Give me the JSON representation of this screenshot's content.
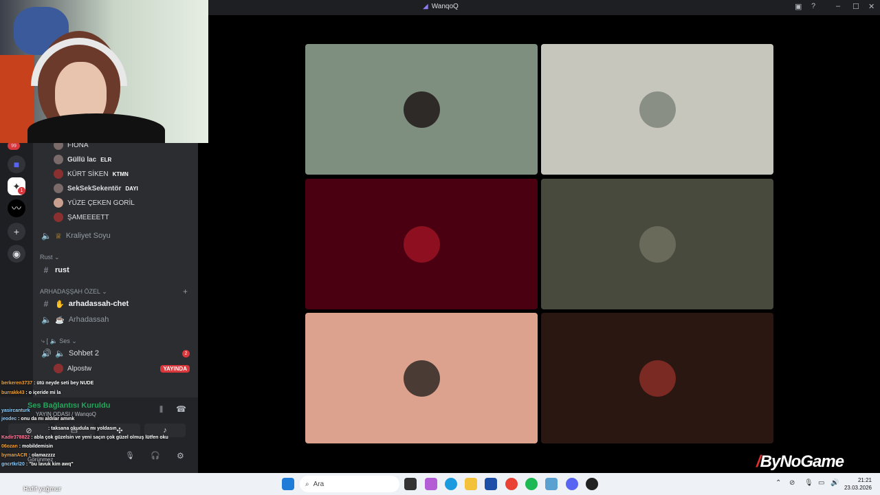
{
  "window": {
    "title": "WanqoQ"
  },
  "watermark": "ByNoGame",
  "sidebar": {
    "members": [
      {
        "name": "FIONA",
        "tag": ""
      },
      {
        "name": "Güllü lac",
        "tag": "ELR"
      },
      {
        "name": "KÜRT SİKEN",
        "tag": "KTMN"
      },
      {
        "name": "SekSekSekentör",
        "tag": "DAYI"
      },
      {
        "name": "YÜZE ÇEKEN GORİL",
        "tag": ""
      },
      {
        "name": "ŞAMEEEETT",
        "tag": ""
      }
    ],
    "channels": {
      "kraliyet": "Kraliyet Soyu",
      "cat_rust": "Rust",
      "rust": "rust",
      "cat_arkadas": "ARHADAŞŞAH ÖZEL",
      "chat": "arhadassah-chet",
      "voice": "Arhadassah",
      "cat_ses": "Ses",
      "sohbet": "Sohbet 2",
      "sohbet_count": "2",
      "alpostw": "Alpostw",
      "live": "YAYINDA"
    },
    "server_badge": "1",
    "top_badge": "99"
  },
  "voice_panel": {
    "status": "Ses Bağlantısı Kuruldu",
    "channel": "YAYIN ODASI / WanqoQ",
    "user": "Görünmez"
  },
  "chat": [
    {
      "user": "berkeren3737",
      "text": ": ütü neyde seti bey NUDE"
    },
    {
      "user": "burrakk43",
      "text": ": o içeride mi la"
    },
    {
      "user": "yasircanturk",
      "text": ""
    },
    {
      "user": "jeodec",
      "text": ": onu da mı aldılar amınk"
    },
    {
      "user": "",
      "text": ": taksana okudula mı yoldasın"
    },
    {
      "user": "Kadir378822",
      "text": ": abla çok güzelsin ve yeni saçın çok güzel olmuş lütfen oku"
    },
    {
      "user": "06ozan",
      "text": ": mobildemisin"
    },
    {
      "user": "bymanACR",
      "text": ": olamazzzz"
    },
    {
      "user": "gncrtkrl20",
      "text": ": \"bu lavuk kim awq\""
    },
    {
      "user": "",
      "text": "Hafif yağmur"
    }
  ],
  "taskbar": {
    "search_placeholder": "Ara",
    "time": "21:21",
    "date": "23.03.2026"
  },
  "tiles": [
    {
      "bg": "#7e8e7f",
      "avatar": "#2e2a28"
    },
    {
      "bg": "#c6c6bd",
      "avatar": "#8a8f86"
    },
    {
      "bg": "#4a0011",
      "avatar": "#8e1020"
    },
    {
      "bg": "#474a3c",
      "avatar": "#6a6a5a"
    },
    {
      "bg": "#dca28d",
      "avatar": "#4a3c35"
    },
    {
      "bg": "#2a1712",
      "avatar": "#7a2a22"
    }
  ]
}
